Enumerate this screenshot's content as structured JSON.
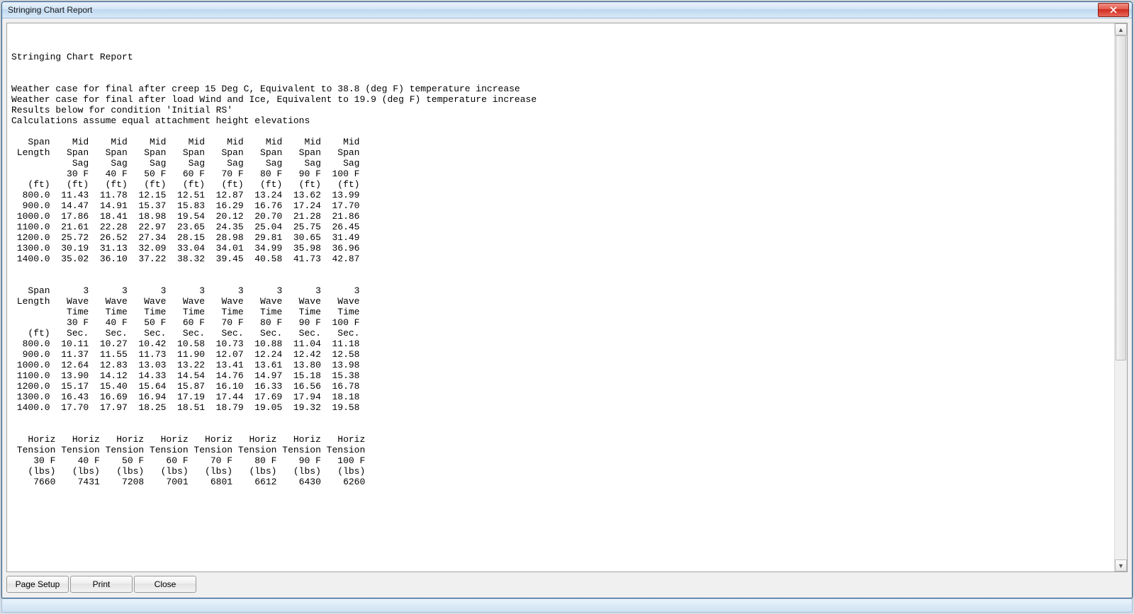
{
  "window": {
    "title": "Stringing Chart Report",
    "close_icon": "close"
  },
  "buttons": {
    "page_setup": "Page Setup",
    "print": "Print",
    "close": "Close"
  },
  "report": {
    "title": "Stringing Chart Report",
    "weather_creep": "Weather case for final after creep 15 Deg C, Equivalent to 38.8 (deg F) temperature increase",
    "weather_load": "Weather case for final after load Wind and Ice, Equivalent to 19.9 (deg F) temperature increase",
    "condition": "Results below for condition 'Initial RS'",
    "assumption": "Calculations assume equal attachment height elevations",
    "temps_F": [
      30,
      40,
      50,
      60,
      70,
      80,
      90,
      100
    ],
    "span_ft": [
      800.0,
      900.0,
      1000.0,
      1100.0,
      1200.0,
      1300.0,
      1400.0
    ],
    "sag_table": {
      "col_group_label": "Mid Span Sag",
      "row_label": "Span Length",
      "unit_row": "(ft)",
      "col_unit": "(ft)",
      "rows": [
        [
          11.43,
          11.78,
          12.15,
          12.51,
          12.87,
          13.24,
          13.62,
          13.99
        ],
        [
          14.47,
          14.91,
          15.37,
          15.83,
          16.29,
          16.76,
          17.24,
          17.7
        ],
        [
          17.86,
          18.41,
          18.98,
          19.54,
          20.12,
          20.7,
          21.28,
          21.86
        ],
        [
          21.61,
          22.28,
          22.97,
          23.65,
          24.35,
          25.04,
          25.75,
          26.45
        ],
        [
          25.72,
          26.52,
          27.34,
          28.15,
          28.98,
          29.81,
          30.65,
          31.49
        ],
        [
          30.19,
          31.13,
          32.09,
          33.04,
          34.01,
          34.99,
          35.98,
          36.96
        ],
        [
          35.02,
          36.1,
          37.22,
          38.32,
          39.45,
          40.58,
          41.73,
          42.87
        ]
      ]
    },
    "wave_table": {
      "col_group_label": "3 Wave Time",
      "row_label": "Span Length",
      "unit_row": "(ft)",
      "col_unit": "Sec.",
      "rows": [
        [
          10.11,
          10.27,
          10.42,
          10.58,
          10.73,
          10.88,
          11.04,
          11.18
        ],
        [
          11.37,
          11.55,
          11.73,
          11.9,
          12.07,
          12.24,
          12.42,
          12.58
        ],
        [
          12.64,
          12.83,
          13.03,
          13.22,
          13.41,
          13.61,
          13.8,
          13.98
        ],
        [
          13.9,
          14.12,
          14.33,
          14.54,
          14.76,
          14.97,
          15.18,
          15.38
        ],
        [
          15.17,
          15.4,
          15.64,
          15.87,
          16.1,
          16.33,
          16.56,
          16.78
        ],
        [
          16.43,
          16.69,
          16.94,
          17.19,
          17.44,
          17.69,
          17.94,
          18.18
        ],
        [
          17.7,
          17.97,
          18.25,
          18.51,
          18.79,
          19.05,
          19.32,
          19.58
        ]
      ]
    },
    "tension_table": {
      "col_group_label": "Horiz Tension",
      "col_unit": "(lbs)",
      "values": [
        7660,
        7431,
        7208,
        7001,
        6801,
        6612,
        6430,
        6260
      ]
    }
  }
}
